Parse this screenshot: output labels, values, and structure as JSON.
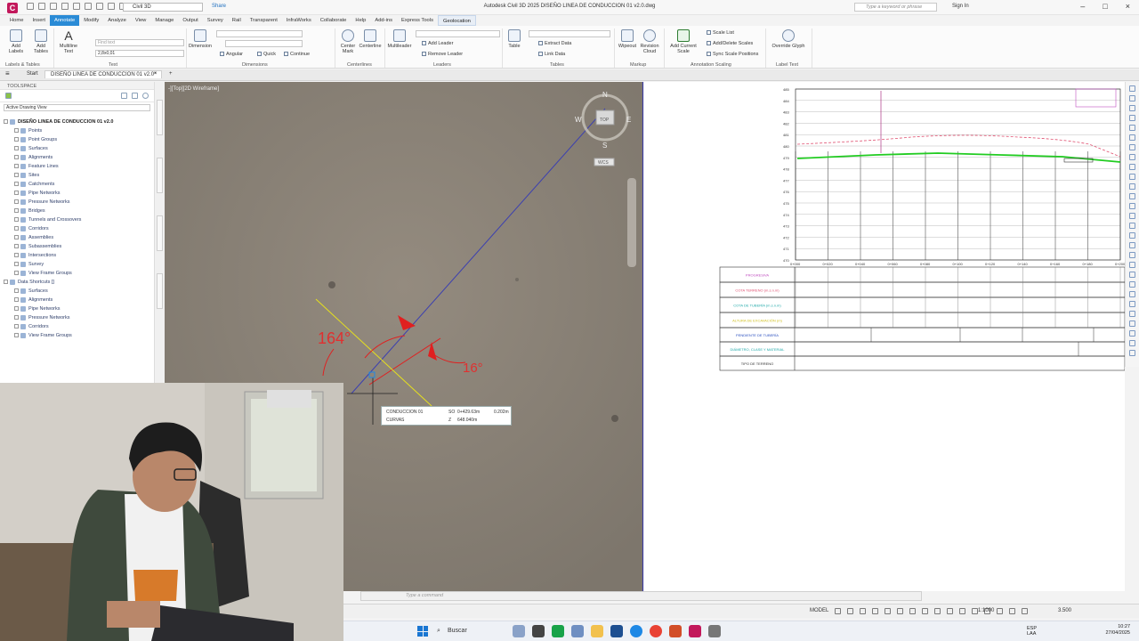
{
  "titlebar": {
    "app_icon": "C",
    "workspace": "Civil 3D",
    "share": "Share",
    "title": "Autodesk Civil 3D 2025   DISEÑO LINEA DE CONDUCCION 01 v2.0.dwg",
    "search_placeholder": "Type a keyword or phrase",
    "sign_in": "Sign In"
  },
  "ribbon_tabs": [
    "Home",
    "Insert",
    "Annotate",
    "Modify",
    "Analyze",
    "View",
    "Manage",
    "Output",
    "Survey",
    "Rail",
    "Transparent",
    "InfraWorks",
    "Collaborate",
    "Help",
    "Add-ins",
    "Express Tools",
    "Geolocation"
  ],
  "ribbon_active_tab": "Annotate",
  "ribbon_highlight_tab": "Geolocation",
  "ribbon": {
    "add_labels": "Add Labels",
    "add_tables": "Add Tables",
    "multiline_text": "Multiline Text",
    "text_style_value": "2,8x0,01",
    "text_find_placeholder": "Find text",
    "dimension": "Dimension",
    "angular": "Angular",
    "quick": "Quick",
    "continue": "Continue",
    "center_mark": "Center Mark",
    "centerline": "Centerline",
    "multileader": "Multileader",
    "add_leader": "Add Leader",
    "remove_leader": "Remove Leader",
    "table": "Table",
    "extract_data": "Extract Data",
    "link_data": "Link Data",
    "wipeout": "Wipeout",
    "revision_cloud": "Revision Cloud",
    "add_current_scale": "Add Current Scale",
    "scale_list": "Scale List",
    "add_delete_scales": "Add/Delete Scales",
    "sync_scale_positions": "Sync Scale Positions",
    "override_glyph": "Override Glyph",
    "groups": {
      "labels_tables": "Labels & Tables",
      "text": "Text",
      "dimensions": "Dimensions",
      "centerlines": "Centerlines",
      "leaders": "Leaders",
      "tables": "Tables",
      "markup": "Markup",
      "annotation_scaling": "Annotation Scaling",
      "label_text": "Label Text"
    }
  },
  "doc_tabs": {
    "start": "Start",
    "active": "DISEÑO LINEA DE CONDUCCION 01 v2.0*",
    "close": "×",
    "add": "+"
  },
  "toolspace": {
    "title": "TOOLSPACE",
    "view_select": "Active Drawing View",
    "root": "DISEÑO LINEA DE CONDUCCION 01 v2.0",
    "items": [
      "Points",
      "Point Groups",
      "Surfaces",
      "Alignments",
      "Feature Lines",
      "Sites",
      "Catchments",
      "Pipe Networks",
      "Pressure Networks",
      "Bridges",
      "Tunnels and Crossovers",
      "Corridors",
      "Assemblies",
      "Subassemblies",
      "Intersections",
      "Survey",
      "View Frame Groups"
    ],
    "data_shortcuts": "Data Shortcuts []",
    "ds_items": [
      "Surfaces",
      "Alignments",
      "Pipe Networks",
      "Pressure Networks",
      "Corridors",
      "View Frame Groups"
    ],
    "side_tabs": [
      "Prospector",
      "Settings",
      "Survey",
      "Toolbox"
    ]
  },
  "viewport": {
    "label": "-][Top][2D Wireframe]",
    "angle_left": "164°",
    "angle_right": "16°",
    "compass": {
      "n": "N",
      "s": "S",
      "e": "E",
      "w": "W",
      "top": "TOP",
      "wcs": "WCS"
    },
    "tooltip": {
      "r1_name": "CONDUCCION 01",
      "r1_key": "SO",
      "r1_val": "0+429.63m",
      "r1_extra": "0.202m",
      "r2_name": "CURVAS",
      "r2_key": "Z",
      "r2_val": "648.040m"
    }
  },
  "profile": {
    "elevations": [
      "485",
      "484",
      "483",
      "482",
      "481",
      "480",
      "479",
      "478",
      "477",
      "476",
      "475",
      "474",
      "473",
      "472",
      "471",
      "470"
    ],
    "stations": [
      "0+000",
      "0+020",
      "0+040",
      "0+060",
      "0+080",
      "0+100",
      "0+120",
      "0+140",
      "0+160",
      "0+180",
      "0+200"
    ],
    "band_rows": [
      "PROGRESIVA",
      "COTA TERRENO (m.s.n.m)",
      "COTA DE TUBERÍA (m.s.n.m)",
      "ALTURA DE EXCAVACIÓN (m)",
      "PENDIENTE DE TUBERÍA",
      "DIÁMETRO, CLASE Y MATERIAL",
      "TIPO DE TERRENO"
    ],
    "colors": {
      "terrain": "#e05070",
      "pipe": "#22cc22",
      "grid": "#555555"
    }
  },
  "command_line": {
    "placeholder": "Type a command"
  },
  "statusbar": {
    "model": "MODEL",
    "scale": "1:1000",
    "scale2": "3.500"
  },
  "taskbar": {
    "search": "Buscar",
    "lang_1": "ESP",
    "lang_2": "LAA",
    "time": "10:27",
    "date": "27/04/2025"
  }
}
